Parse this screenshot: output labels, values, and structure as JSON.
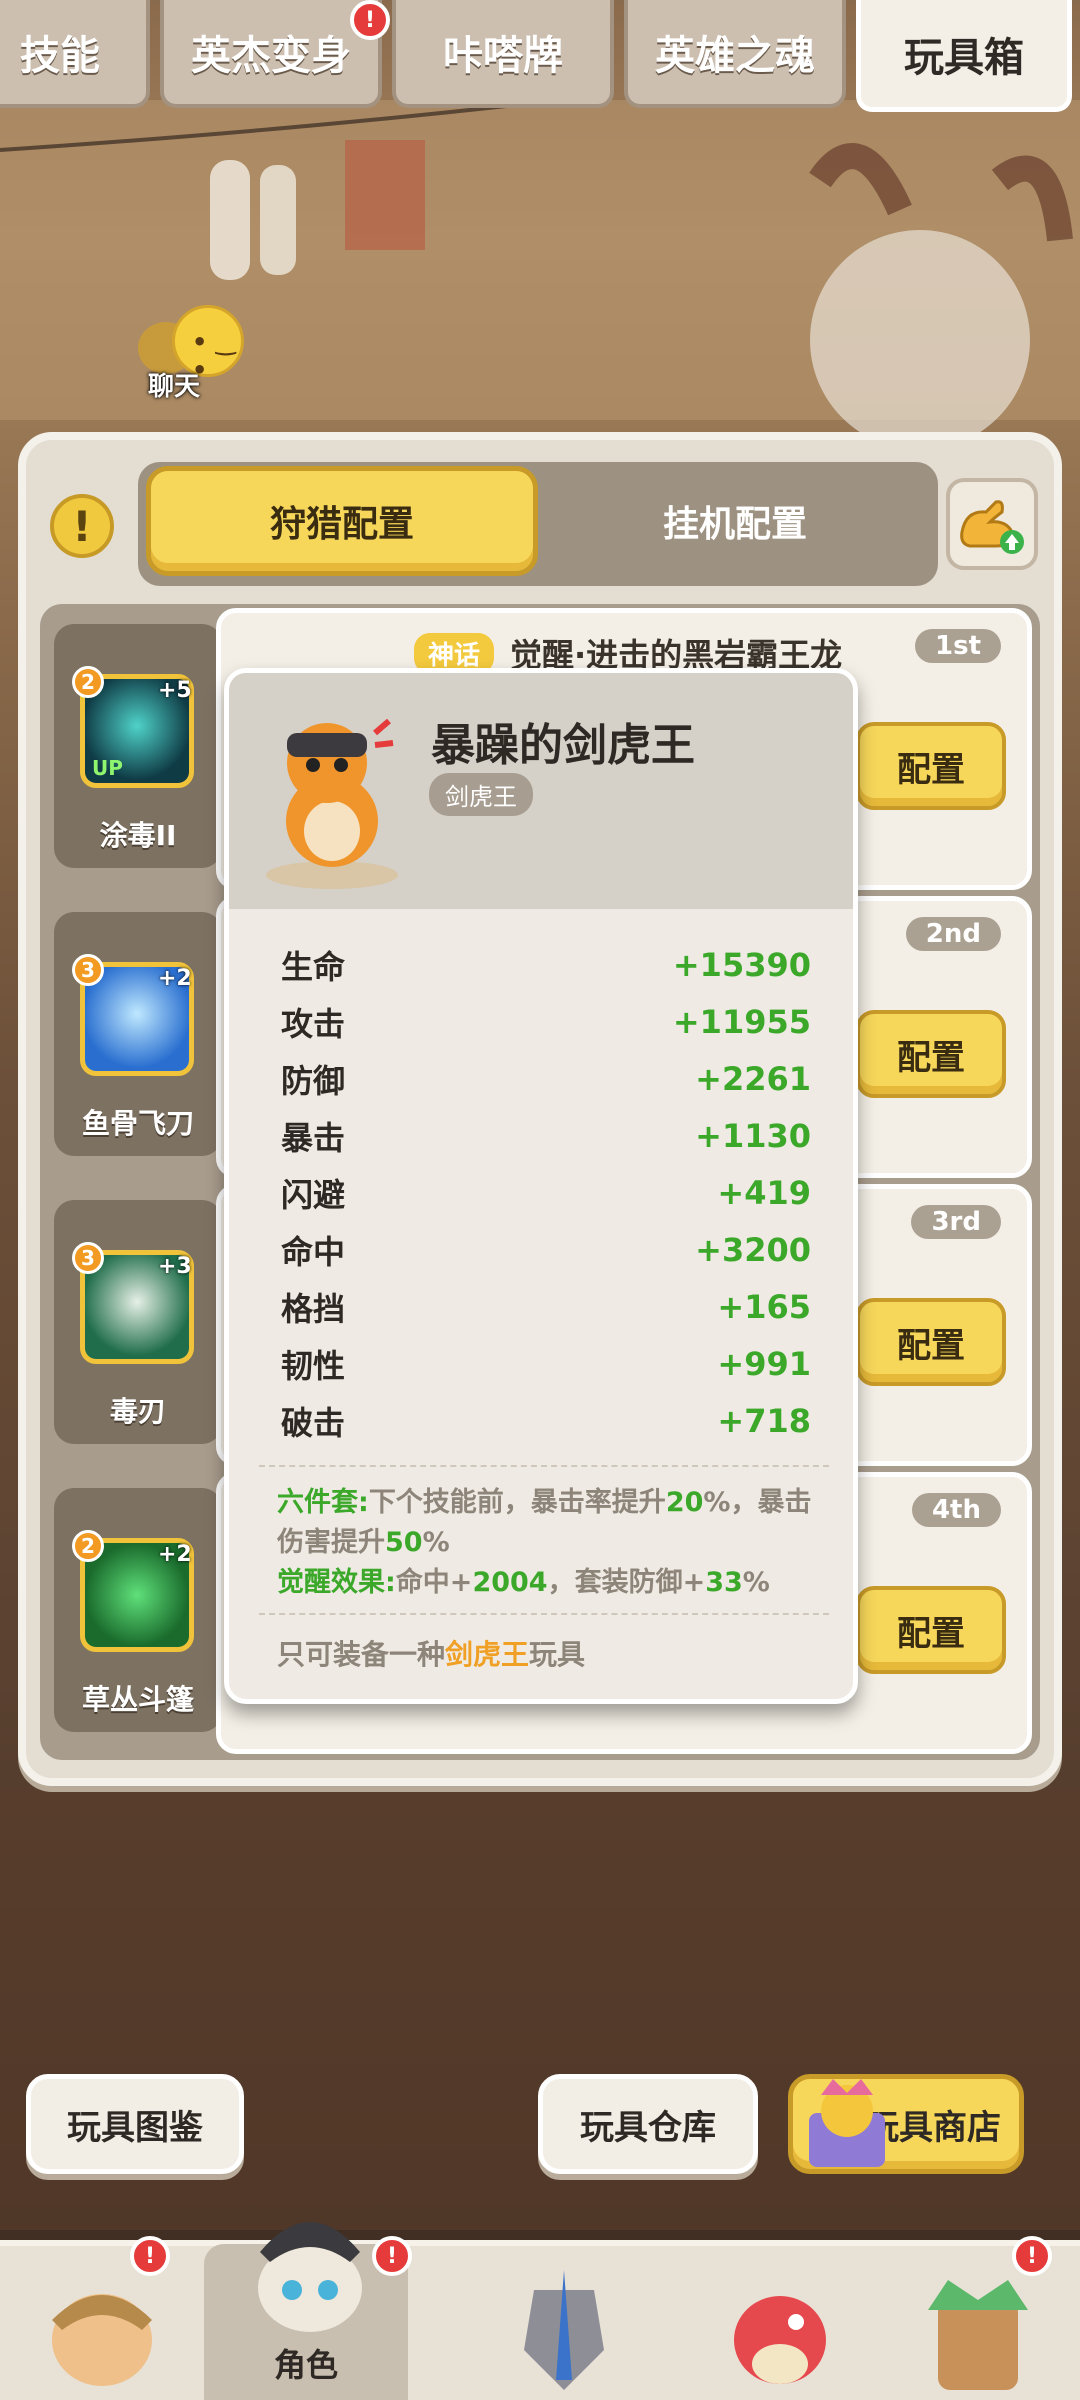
{
  "tabs": [
    {
      "label": "技能"
    },
    {
      "label": "英杰变身"
    },
    {
      "label": "咔嗒牌"
    },
    {
      "label": "英雄之魂"
    },
    {
      "label": "玩具箱"
    }
  ],
  "chat": {
    "label": "聊天"
  },
  "config_tabs": {
    "hunt": "狩猎配置",
    "idle": "挂机配置"
  },
  "skills": [
    {
      "name": "涂毒II",
      "level": "2",
      "plus": "+5",
      "up": "UP"
    },
    {
      "name": "鱼骨飞刀",
      "level": "3",
      "plus": "+2"
    },
    {
      "name": "毒刃",
      "level": "3",
      "plus": "+3"
    },
    {
      "name": "草丛斗篷",
      "level": "2",
      "plus": "+2"
    }
  ],
  "toy_rows": [
    {
      "rank": "1st",
      "badge": "神话",
      "title": "觉醒·进击的黑岩霸王龙",
      "button": "配置"
    },
    {
      "rank": "2nd",
      "button": "配置"
    },
    {
      "rank": "3rd",
      "button": "配置"
    },
    {
      "rank": "4th",
      "button": "配置"
    }
  ],
  "popup": {
    "title": "暴躁的剑虎王",
    "tag": "剑虎王",
    "stats": [
      {
        "name": "生命",
        "value": "+15390"
      },
      {
        "name": "攻击",
        "value": "+11955"
      },
      {
        "name": "防御",
        "value": "+2261"
      },
      {
        "name": "暴击",
        "value": "+1130"
      },
      {
        "name": "闪避",
        "value": "+419"
      },
      {
        "name": "命中",
        "value": "+3200"
      },
      {
        "name": "格挡",
        "value": "+165"
      },
      {
        "name": "韧性",
        "value": "+991"
      },
      {
        "name": "破击",
        "value": "+718"
      }
    ],
    "set_label": "六件套:",
    "set_text_1": "下个技能前，暴击率提升",
    "set_val_1": "20",
    "set_text_2": "%，暴击伤害提升",
    "set_val_2": "50",
    "set_text_3": "%",
    "awaken_label": "觉醒效果:",
    "awaken_text_1": "命中+",
    "awaken_val_1": "2004",
    "awaken_text_2": "，套装防御+",
    "awaken_val_2": "33",
    "awaken_text_3": "%",
    "only_1": "只可装备一种",
    "only_2": "剑虎王",
    "only_3": "玩具"
  },
  "bottom_buttons": {
    "catalog": "玩具图鉴",
    "storage": "玩具仓库",
    "shop": "玩具商店"
  },
  "nav": {
    "active_label": "角色"
  },
  "colors": {
    "accent_yellow": "#f7d75a",
    "stat_green": "#3ba82a",
    "highlight_orange": "#f0a024",
    "alert_red": "#e63b3b"
  }
}
